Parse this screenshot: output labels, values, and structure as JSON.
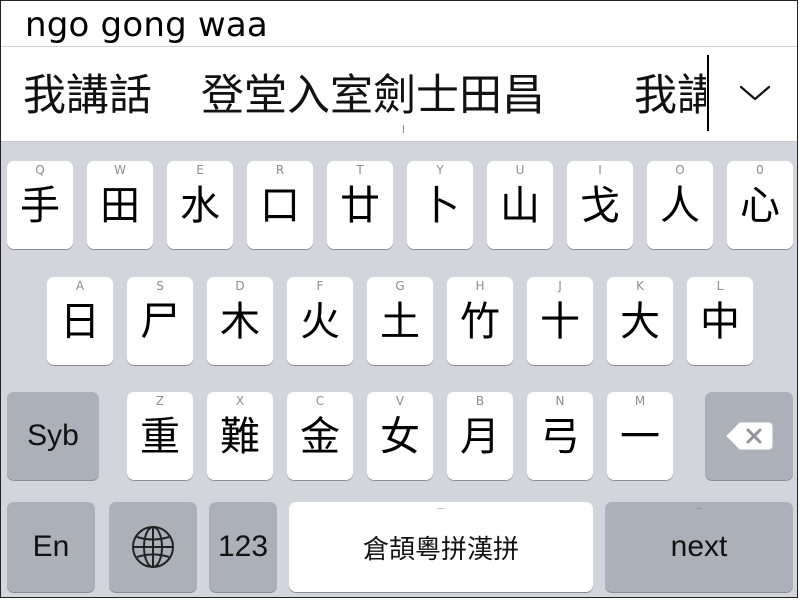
{
  "composing": {
    "text": "ngo gong waa"
  },
  "candidates": {
    "items": [
      "我講話",
      "登堂入室劍士田昌",
      "我講"
    ]
  },
  "keyboard": {
    "row1": [
      {
        "hint": "Q",
        "glyph": "手"
      },
      {
        "hint": "W",
        "glyph": "田"
      },
      {
        "hint": "E",
        "glyph": "水"
      },
      {
        "hint": "R",
        "glyph": "口"
      },
      {
        "hint": "T",
        "glyph": "廿"
      },
      {
        "hint": "Y",
        "glyph": "卜"
      },
      {
        "hint": "U",
        "glyph": "山"
      },
      {
        "hint": "I",
        "glyph": "戈"
      },
      {
        "hint": "O",
        "glyph": "人"
      },
      {
        "hint": "0",
        "glyph": "心"
      }
    ],
    "row2": [
      {
        "hint": "A",
        "glyph": "日"
      },
      {
        "hint": "S",
        "glyph": "尸"
      },
      {
        "hint": "D",
        "glyph": "木"
      },
      {
        "hint": "F",
        "glyph": "火"
      },
      {
        "hint": "G",
        "glyph": "土"
      },
      {
        "hint": "H",
        "glyph": "竹"
      },
      {
        "hint": "J",
        "glyph": "十"
      },
      {
        "hint": "K",
        "glyph": "大"
      },
      {
        "hint": "L",
        "glyph": "中"
      }
    ],
    "row3": [
      {
        "hint": "Z",
        "glyph": "重"
      },
      {
        "hint": "X",
        "glyph": "難"
      },
      {
        "hint": "C",
        "glyph": "金"
      },
      {
        "hint": "V",
        "glyph": "女"
      },
      {
        "hint": "B",
        "glyph": "月"
      },
      {
        "hint": "N",
        "glyph": "弓"
      },
      {
        "hint": "M",
        "glyph": "一"
      }
    ],
    "syb_label": "Syb",
    "backspace_icon": "backspace-icon",
    "en_label": "En",
    "globe_icon": "globe-icon",
    "num_label": "123",
    "space_label": "倉頡粵拼漢拼",
    "next_label": "next"
  },
  "colors": {
    "keyboard_bg": "#d2d5db",
    "key_light": "#ffffff",
    "key_dark": "#acb1b9"
  }
}
